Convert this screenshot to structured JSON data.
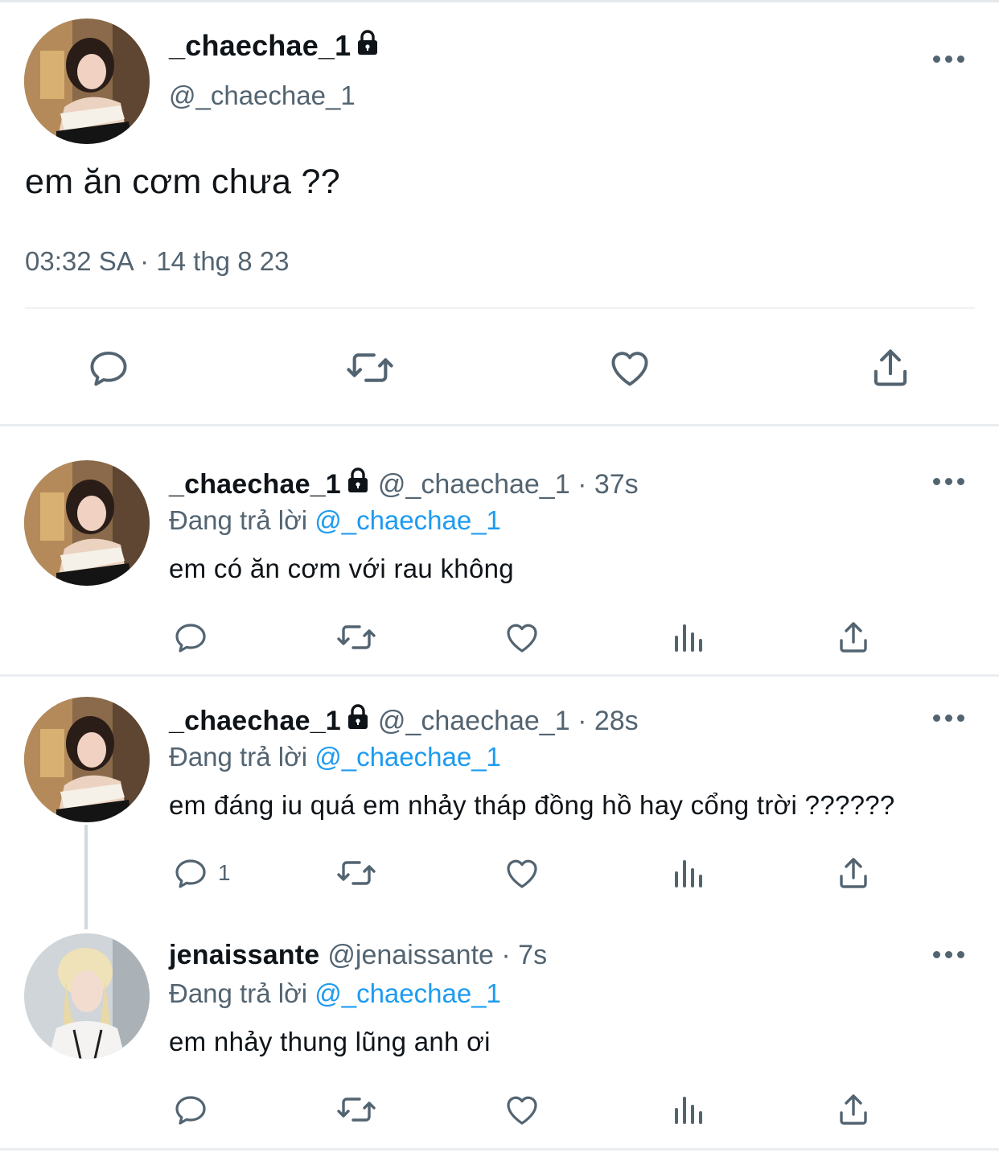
{
  "main_tweet": {
    "name": "_chaechae_1",
    "handle": "@_chaechae_1",
    "text": "em ăn cơm chưa ??",
    "timestamp": "03:32 SA · 14 thg 8 23",
    "avatar_icon": "avatar-photo-chaechae",
    "actions": [
      "reply-icon",
      "retweet-icon",
      "like-icon",
      "share-icon"
    ]
  },
  "replies": [
    {
      "name": "_chaechae_1",
      "handle": "@_chaechae_1",
      "time": "37s",
      "replying_to_label": "Đang trả lời",
      "replying_to_handle": "@_chaechae_1",
      "text": "em có ăn cơm với rau không",
      "reply_count": ""
    },
    {
      "name": "_chaechae_1",
      "handle": "@_chaechae_1",
      "time": "28s",
      "replying_to_label": "Đang trả lời",
      "replying_to_handle": "@_chaechae_1",
      "text": "em đáng iu quá em nhảy tháp đồng hồ hay cổng trời ??????",
      "reply_count": "1"
    },
    {
      "name": "jenaissante",
      "handle": "@jenaissante",
      "time": "7s",
      "replying_to_label": "Đang trả lời",
      "replying_to_handle": "@_chaechae_1",
      "text": "em nhảy thung lũng anh ơi",
      "reply_count": ""
    }
  ],
  "separator": " · ",
  "colors": {
    "text": "#0f1419",
    "secondary": "#536471",
    "link": "#1d9bf0",
    "divider": "#eaedf0"
  }
}
